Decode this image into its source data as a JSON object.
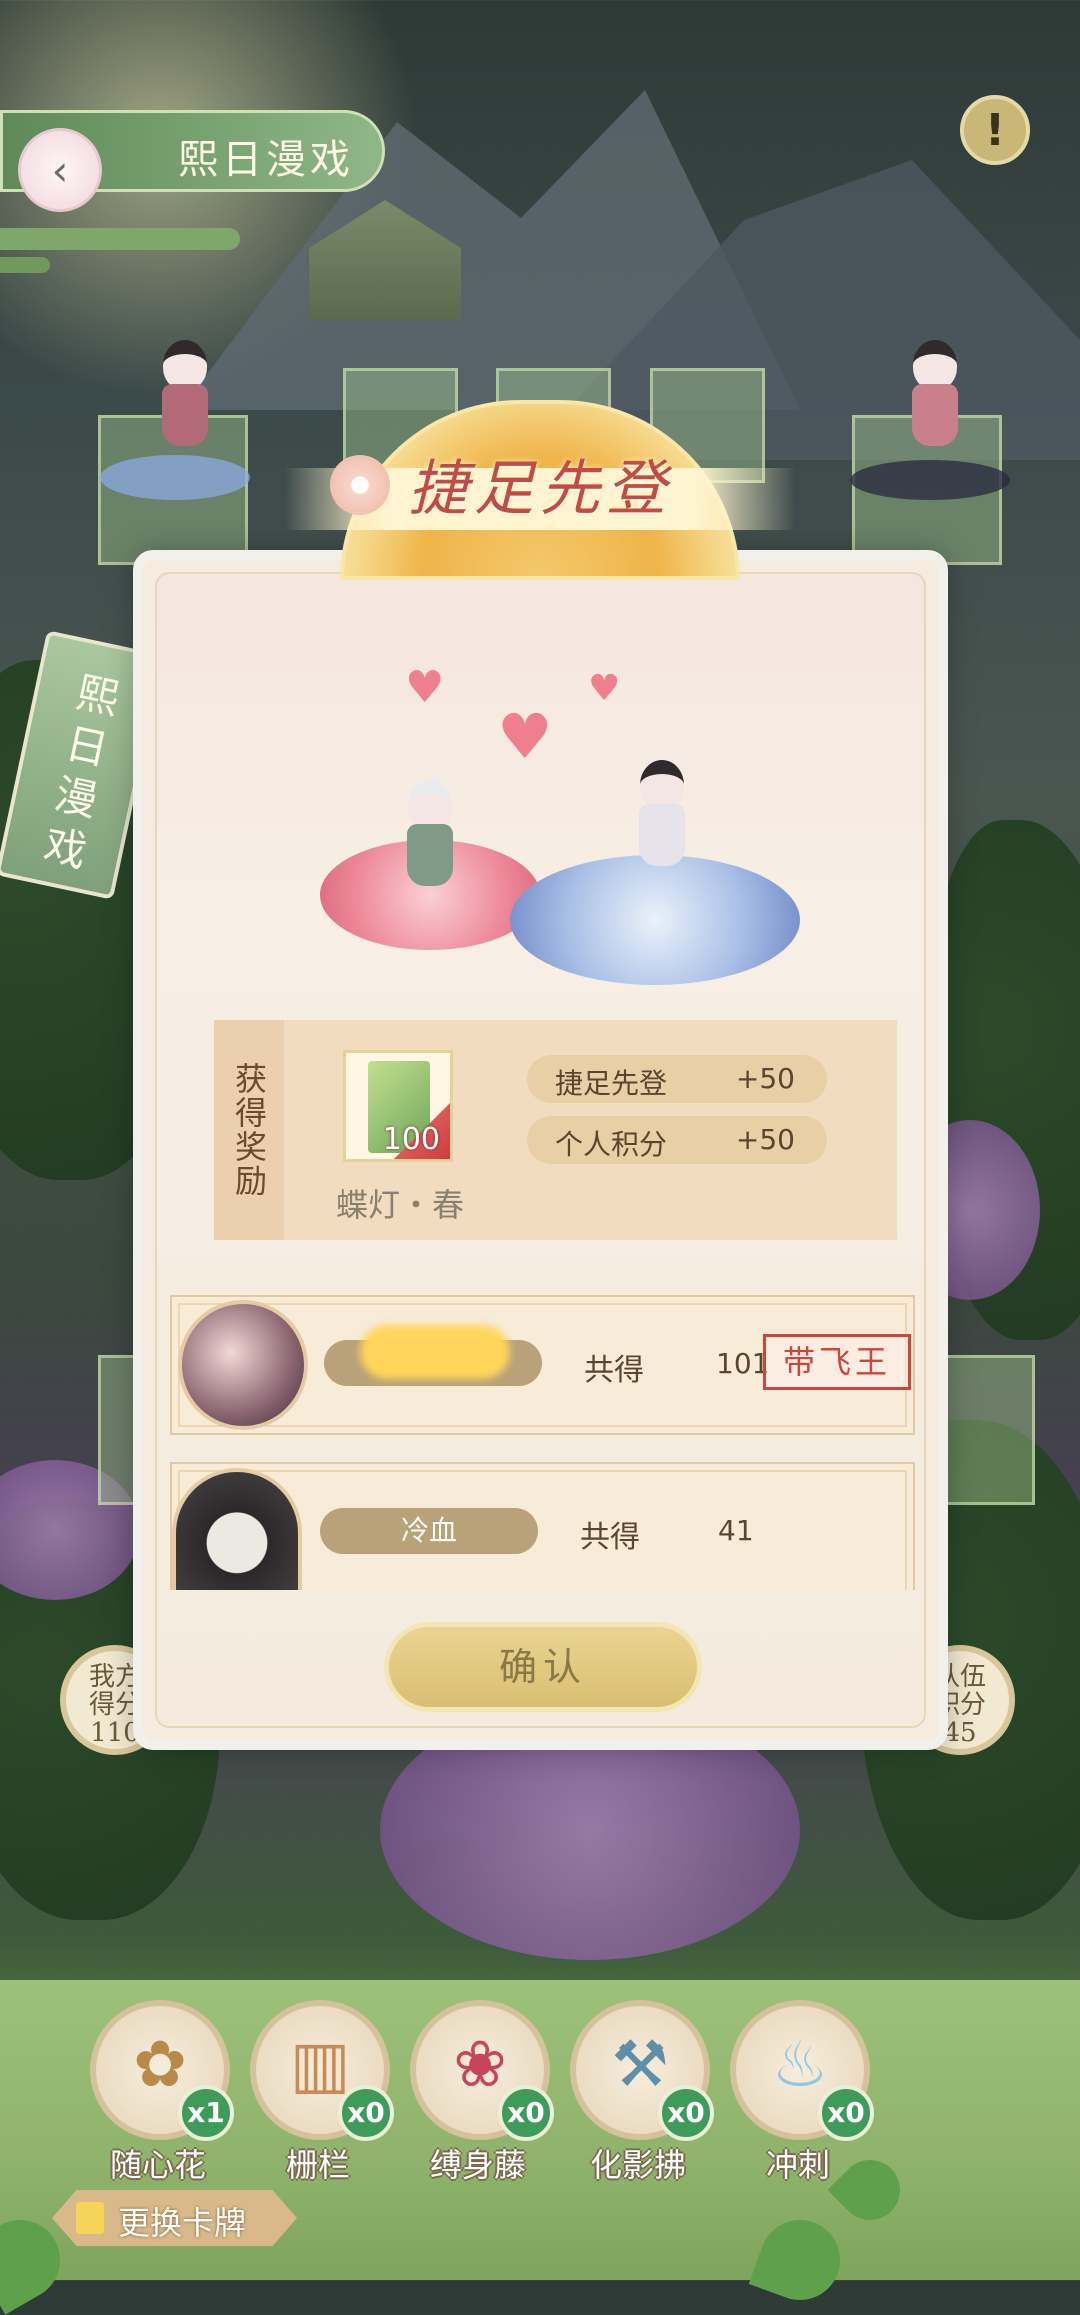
{
  "header": {
    "title": "熙日漫戏"
  },
  "tag": {
    "text": "熙日漫戏"
  },
  "side": {
    "left_badge": "我方\n得分\n110",
    "right_badge": "队伍\n积分\n45"
  },
  "modal": {
    "banner_title": "捷足先登",
    "reward_label": "获得奖励",
    "item": {
      "name": "蝶灯・春",
      "count": "100"
    },
    "reward_rows": [
      {
        "label": "捷足先登",
        "value": "+50"
      },
      {
        "label": "个人积分",
        "value": "+50"
      }
    ],
    "players": [
      {
        "name": "",
        "gain_label": "共得",
        "score": "101",
        "badge": "带飞王"
      },
      {
        "name": "冷血",
        "gain_label": "共得",
        "score": "41"
      }
    ],
    "confirm_label": "确认"
  },
  "skills": [
    {
      "name": "随心花",
      "count": "x1",
      "icon": "flower-basket-icon"
    },
    {
      "name": "栅栏",
      "count": "x0",
      "icon": "fence-icon"
    },
    {
      "name": "缚身藤",
      "count": "x0",
      "icon": "vine-plant-icon"
    },
    {
      "name": "化影拂",
      "count": "x0",
      "icon": "whisk-icon"
    },
    {
      "name": "冲刺",
      "count": "x0",
      "icon": "flame-icon"
    }
  ],
  "footer": {
    "change_card_label": "更换卡牌"
  },
  "colors": {
    "modal_bg": "#f5ecdf",
    "accent_green": "#3f9b5a",
    "stamp_red": "#c9473e",
    "banner_gold": "#f0b44a"
  }
}
